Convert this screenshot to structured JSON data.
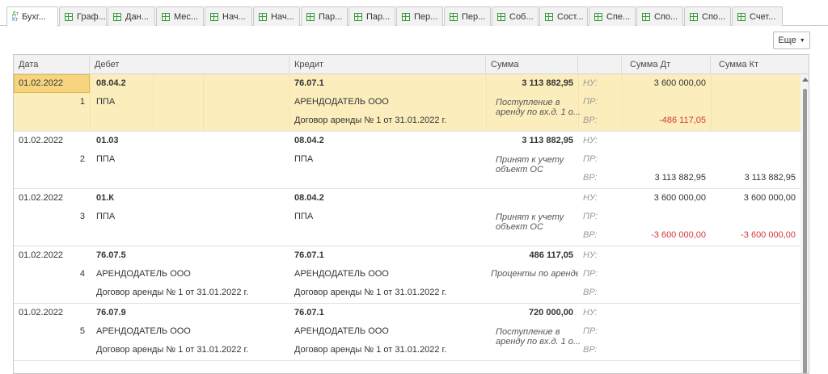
{
  "tabs": [
    {
      "label": "Бухг...",
      "icon": "debit-credit-icon",
      "active": true
    },
    {
      "label": "Граф...",
      "icon": "table-icon"
    },
    {
      "label": "Дан...",
      "icon": "table-icon"
    },
    {
      "label": "Мес...",
      "icon": "table-icon"
    },
    {
      "label": "Нач...",
      "icon": "table-icon"
    },
    {
      "label": "Нач...",
      "icon": "table-icon"
    },
    {
      "label": "Пар...",
      "icon": "table-icon"
    },
    {
      "label": "Пар...",
      "icon": "table-icon"
    },
    {
      "label": "Пер...",
      "icon": "table-icon"
    },
    {
      "label": "Пер...",
      "icon": "table-icon"
    },
    {
      "label": "Соб...",
      "icon": "table-icon"
    },
    {
      "label": "Сост...",
      "icon": "table-icon"
    },
    {
      "label": "Спе...",
      "icon": "table-icon"
    },
    {
      "label": "Спо...",
      "icon": "table-icon"
    },
    {
      "label": "Спо...",
      "icon": "table-icon"
    },
    {
      "label": "Счет...",
      "icon": "table-icon"
    }
  ],
  "toolbar": {
    "more_label": "Еще"
  },
  "columns": {
    "date": "Дата",
    "debit": "Дебет",
    "credit": "Кредит",
    "sum": "Сумма",
    "type": "",
    "sum_dt": "Сумма Дт",
    "sum_kt": "Сумма Кт"
  },
  "marks": {
    "nu": "НУ:",
    "pr": "ПР:",
    "vr": "ВР:"
  },
  "records": [
    {
      "date": "01.02.2022",
      "num": "1",
      "debit": [
        "08.04.2",
        "ППА",
        ""
      ],
      "credit": [
        "76.07.1",
        "АРЕНДОДАТЕЛЬ ООО",
        "Договор аренды № 1 от 31.01.2022 г."
      ],
      "sum": "3 113 882,95",
      "note": "Поступление в аренду по вх.д. 1 о...",
      "nu_dt": "3 600 000,00",
      "nu_kt": "",
      "vr_dt": "-486 117,05",
      "vr_kt": ""
    },
    {
      "date": "01.02.2022",
      "num": "2",
      "debit": [
        "01.03",
        "ППА",
        ""
      ],
      "credit": [
        "08.04.2",
        "ППА",
        ""
      ],
      "sum": "3 113 882,95",
      "note": "Принят к учету объект ОС",
      "nu_dt": "",
      "nu_kt": "",
      "vr_dt": "3 113 882,95",
      "vr_kt": "3 113 882,95"
    },
    {
      "date": "01.02.2022",
      "num": "3",
      "debit": [
        "01.К",
        "ППА",
        ""
      ],
      "credit": [
        "08.04.2",
        "ППА",
        ""
      ],
      "sum": "",
      "note": "Принят к учету объект ОС",
      "nu_dt": "3 600 000,00",
      "nu_kt": "3 600 000,00",
      "vr_dt": "-3 600 000,00",
      "vr_kt": "-3 600 000,00"
    },
    {
      "date": "01.02.2022",
      "num": "4",
      "debit": [
        "76.07.5",
        "АРЕНДОДАТЕЛЬ ООО",
        "Договор аренды № 1 от 31.01.2022 г."
      ],
      "credit": [
        "76.07.1",
        "АРЕНДОДАТЕЛЬ ООО",
        "Договор аренды № 1 от 31.01.2022 г."
      ],
      "sum": "486 117,05",
      "note": "Проценты по аренде",
      "nu_dt": "",
      "nu_kt": "",
      "vr_dt": "",
      "vr_kt": ""
    },
    {
      "date": "01.02.2022",
      "num": "5",
      "debit": [
        "76.07.9",
        "АРЕНДОДАТЕЛЬ ООО",
        "Договор аренды № 1 от 31.01.2022 г."
      ],
      "credit": [
        "76.07.1",
        "АРЕНДОДАТЕЛЬ ООО",
        "Договор аренды № 1 от 31.01.2022 г."
      ],
      "sum": "720 000,00",
      "note": "Поступление в аренду по вх.д. 1 о...",
      "nu_dt": "",
      "nu_kt": "",
      "vr_dt": "",
      "vr_kt": ""
    }
  ],
  "colors": {
    "selected_row": "#fbeebc",
    "negative": "#d23a3a",
    "tab_icon": "#3a9a3a"
  }
}
